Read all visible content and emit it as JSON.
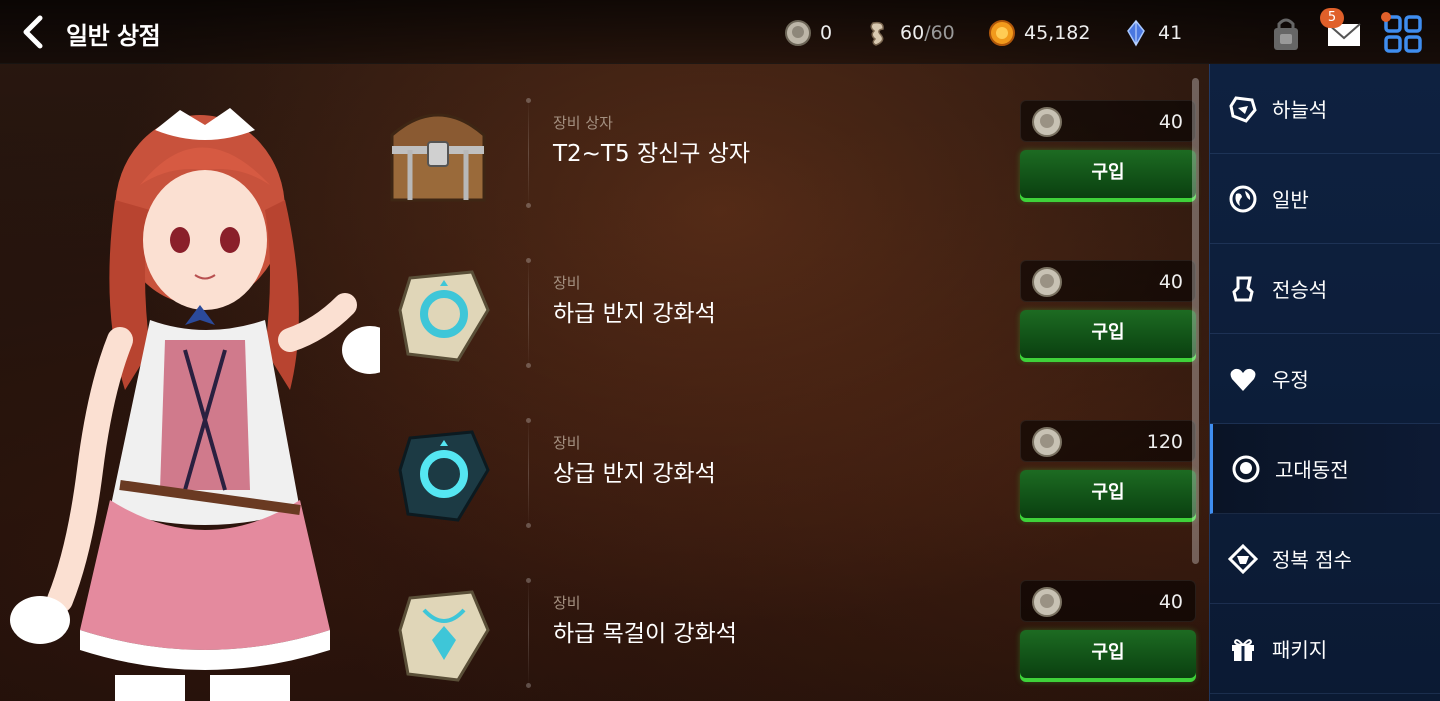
{
  "header": {
    "title": "일반 상점",
    "currencies": [
      {
        "icon": "ancient-coin-icon",
        "value": "0"
      },
      {
        "icon": "stamina-icon",
        "value": "60",
        "max": "/60"
      },
      {
        "icon": "gold-icon",
        "value": "45,182"
      },
      {
        "icon": "crystal-icon",
        "value": "41"
      }
    ],
    "mail_badge": "5"
  },
  "items": [
    {
      "category": "장비 상자",
      "name": "T2~T5 장신구 상자",
      "price": "40",
      "buy_label": "구입",
      "icon": "chest-icon"
    },
    {
      "category": "장비",
      "name": "하급 반지 강화석",
      "price": "40",
      "buy_label": "구입",
      "icon": "ring-stone-low-icon"
    },
    {
      "category": "장비",
      "name": "상급 반지 강화석",
      "price": "120",
      "buy_label": "구입",
      "icon": "ring-stone-high-icon"
    },
    {
      "category": "장비",
      "name": "하급 목걸이 강화석",
      "price": "40",
      "buy_label": "구입",
      "icon": "necklace-stone-low-icon"
    }
  ],
  "sidebar": {
    "items": [
      {
        "label": "하늘석",
        "icon": "sky-stone-icon"
      },
      {
        "label": "일반",
        "icon": "globe-icon"
      },
      {
        "label": "전승석",
        "icon": "bust-icon"
      },
      {
        "label": "우정",
        "icon": "heart-icon"
      },
      {
        "label": "고대동전",
        "icon": "ancient-coin-icon",
        "active": true
      },
      {
        "label": "정복 점수",
        "icon": "conquest-icon"
      },
      {
        "label": "패키지",
        "icon": "gift-icon"
      }
    ]
  },
  "colors": {
    "accent": "#3f8ef0",
    "buy_green": "#3fd23a",
    "badge": "#e0602a"
  }
}
